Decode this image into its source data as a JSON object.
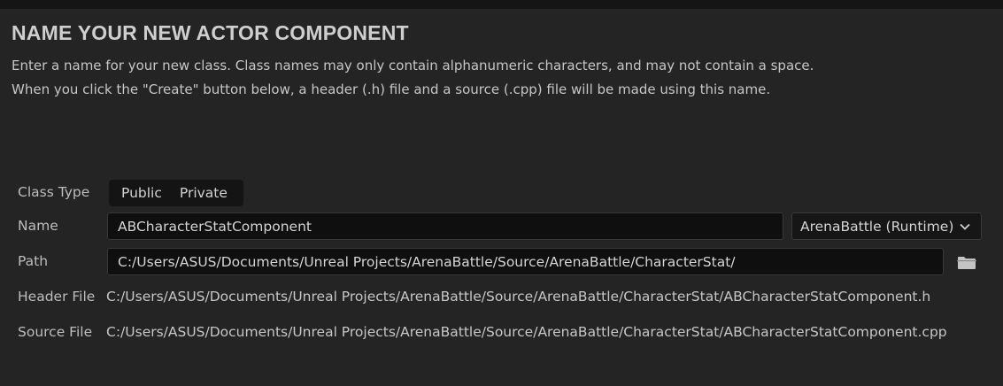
{
  "dialog": {
    "title": "NAME YOUR NEW ACTOR COMPONENT",
    "description_line1": "Enter a name for your new class. Class names may only contain alphanumeric characters, and may not contain a space.",
    "description_line2": "When you click the \"Create\" button below, a header (.h) file and a source (.cpp) file will be made using this name."
  },
  "form": {
    "class_type": {
      "label": "Class Type",
      "options": [
        "Public",
        "Private"
      ]
    },
    "name": {
      "label": "Name",
      "value": "ABCharacterStatComponent"
    },
    "module": {
      "selected": "ArenaBattle (Runtime)",
      "icon": "chevron-down-icon"
    },
    "path": {
      "label": "Path",
      "value": "C:/Users/ASUS/Documents/Unreal Projects/ArenaBattle/Source/ArenaBattle/CharacterStat/",
      "browse_icon": "folder-icon"
    },
    "header_file": {
      "label": "Header File",
      "value": "C:/Users/ASUS/Documents/Unreal Projects/ArenaBattle/Source/ArenaBattle/CharacterStat/ABCharacterStatComponent.h"
    },
    "source_file": {
      "label": "Source File",
      "value": "C:/Users/ASUS/Documents/Unreal Projects/ArenaBattle/Source/ArenaBattle/CharacterStat/ABCharacterStatComponent.cpp"
    }
  },
  "colors": {
    "background": "#242424",
    "field_background": "#0f0f0f",
    "text": "#c6c6c6",
    "title": "#cfcfcf"
  }
}
